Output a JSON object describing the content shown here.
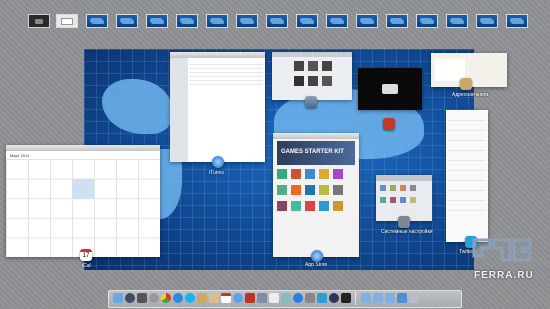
{
  "spaces": {
    "count": 15
  },
  "windows": {
    "itunes_label": "iTunes",
    "appstore_banner": "GAMES STARTER KIT",
    "appstore_label": "App Store",
    "sysprefs_label": "Системные настройки",
    "ical_label": "iCal",
    "ical_day": "17",
    "calendar_month": "Март 2011",
    "address_label": "Адресная книга",
    "photobooth_label": "Photo Booth",
    "preview_label": "Просмотр",
    "twitter_label": "Twitter"
  },
  "watermark": {
    "text": "FERRA.RU"
  },
  "colors": {
    "desktop": "#124f9c",
    "continent": "#6fb4ec",
    "watermark": "#8aa0b8"
  }
}
